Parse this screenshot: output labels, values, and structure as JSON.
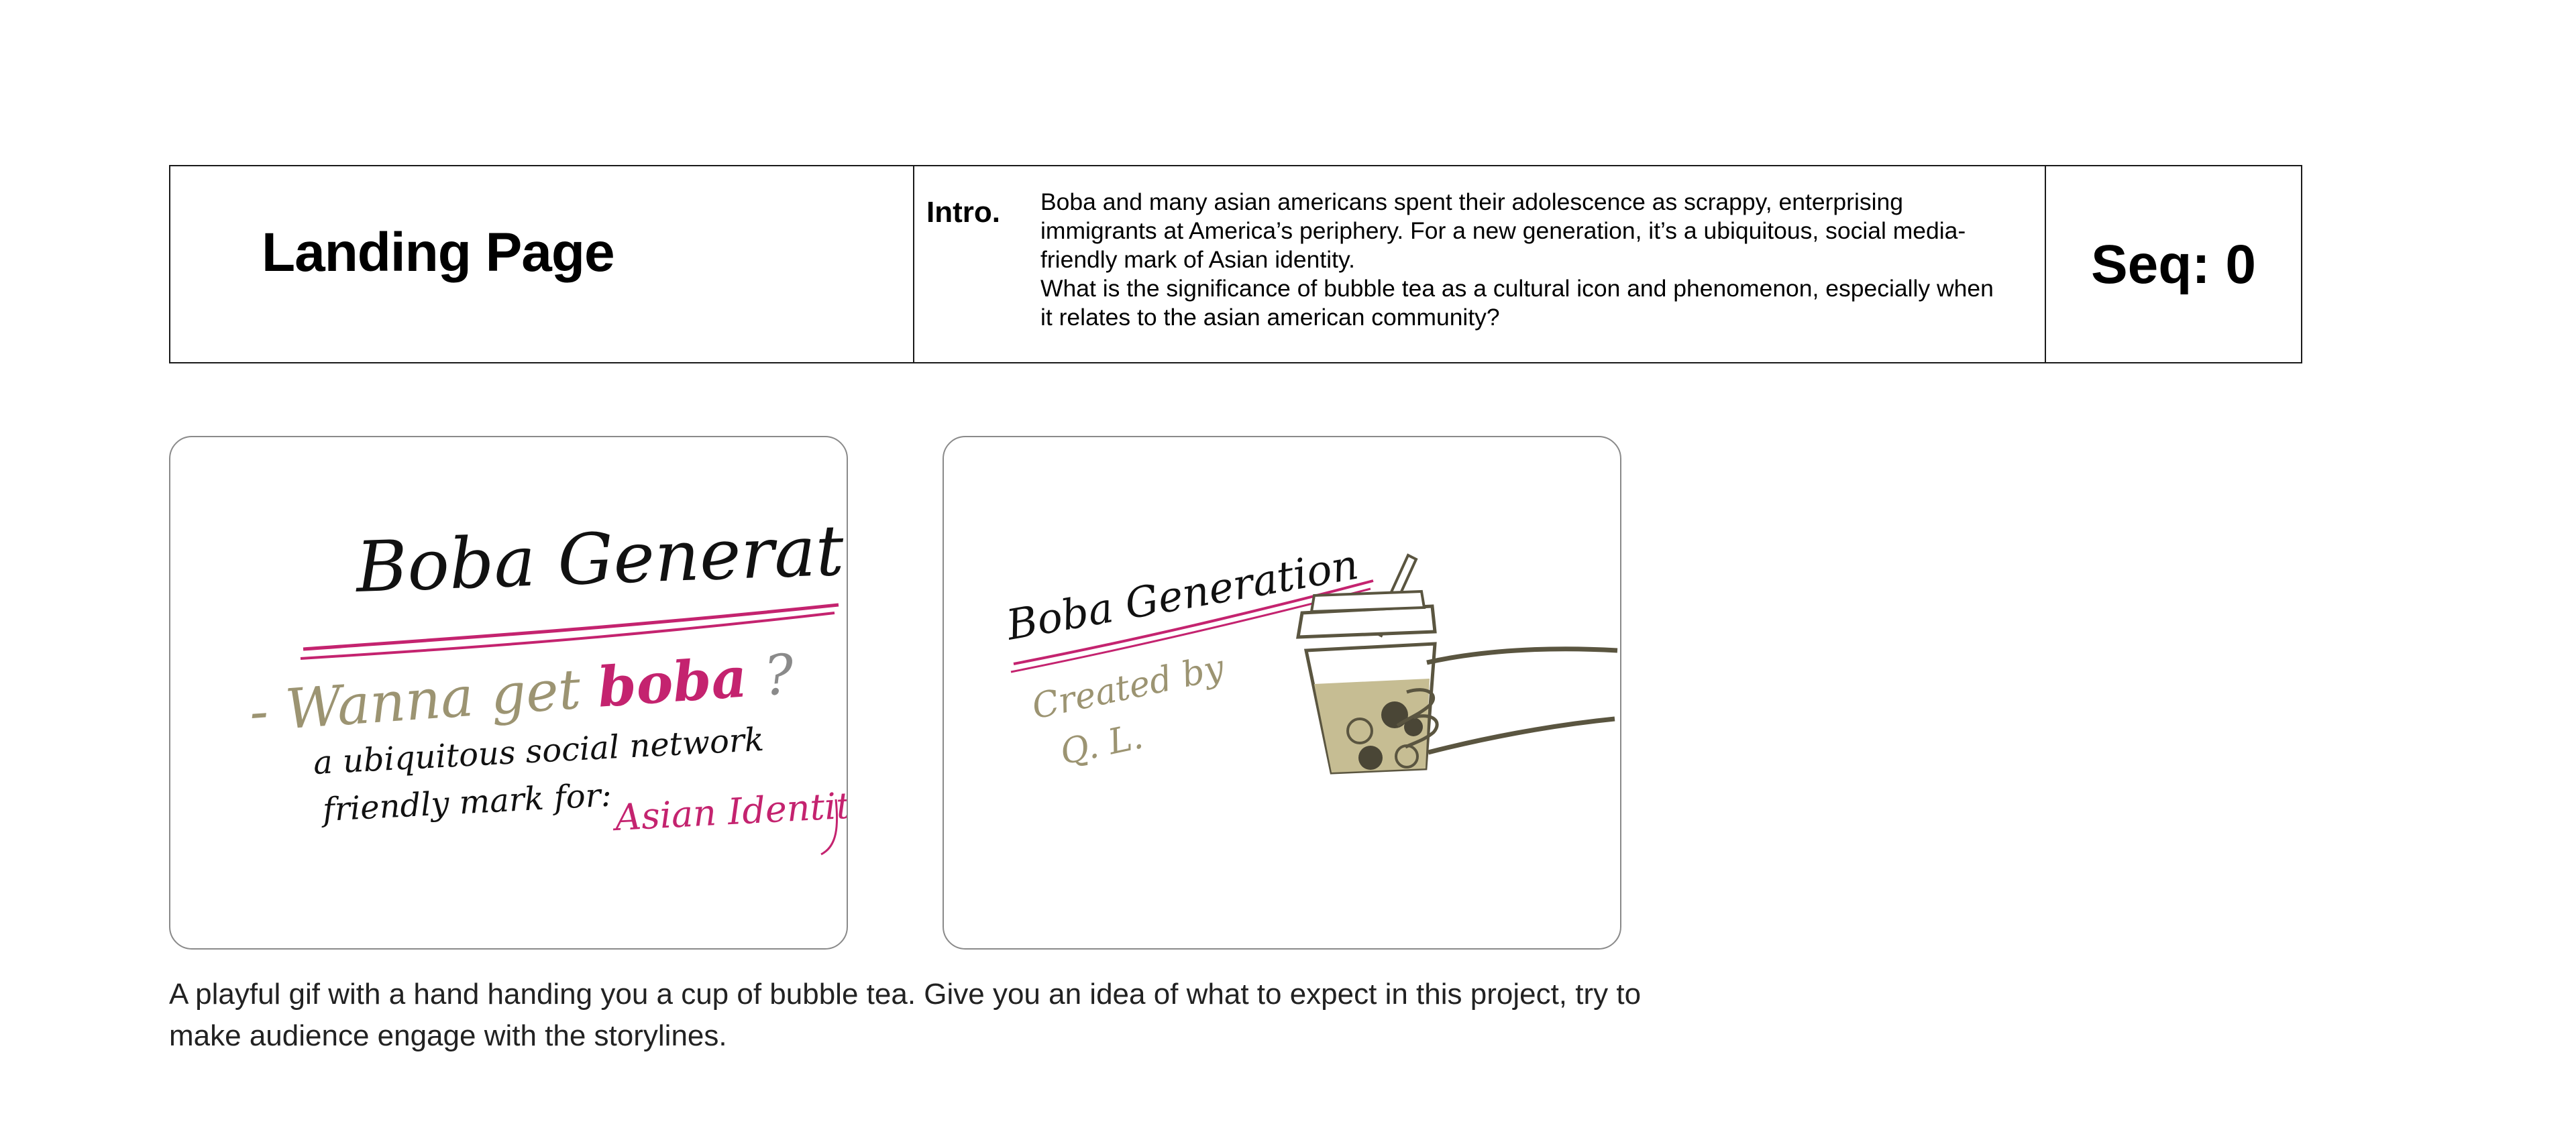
{
  "header": {
    "title": "Landing Page",
    "intro_label": "Intro.",
    "intro_paragraphs": [
      "Boba and many asian americans spent their adolescence as scrappy, enterprising immigrants at America’s periphery. For a new generation, it’s a ubiquitous, social media-friendly mark of Asian identity.",
      "What is the significance of bubble tea as a cultural icon and phenomenon, especially when it relates to the asian american community?"
    ],
    "seq_label": "Seq: 0"
  },
  "sketch_1": {
    "title": "Boba Generation",
    "line_1_prefix": "- Wanna get ",
    "line_1_highlight": "boba",
    "line_1_suffix": " ?",
    "line_2": "a ubiquitous social network",
    "line_3": "friendly mark for:",
    "highlight_text": "Asian Identity"
  },
  "sketch_2": {
    "title": "Boba Generation",
    "credit_line_1": "Created by",
    "credit_line_2": "Q. L."
  },
  "caption": "A playful gif with a hand handing you a cup of bubble tea. Give you an idea of what to expect in this project, try to make audience engage with the storylines.",
  "colors": {
    "ink": "#111111",
    "magenta": "#c4236f",
    "olive": "#9c9472",
    "tea": "#c6bd93",
    "cup_outline": "#5a5540"
  }
}
